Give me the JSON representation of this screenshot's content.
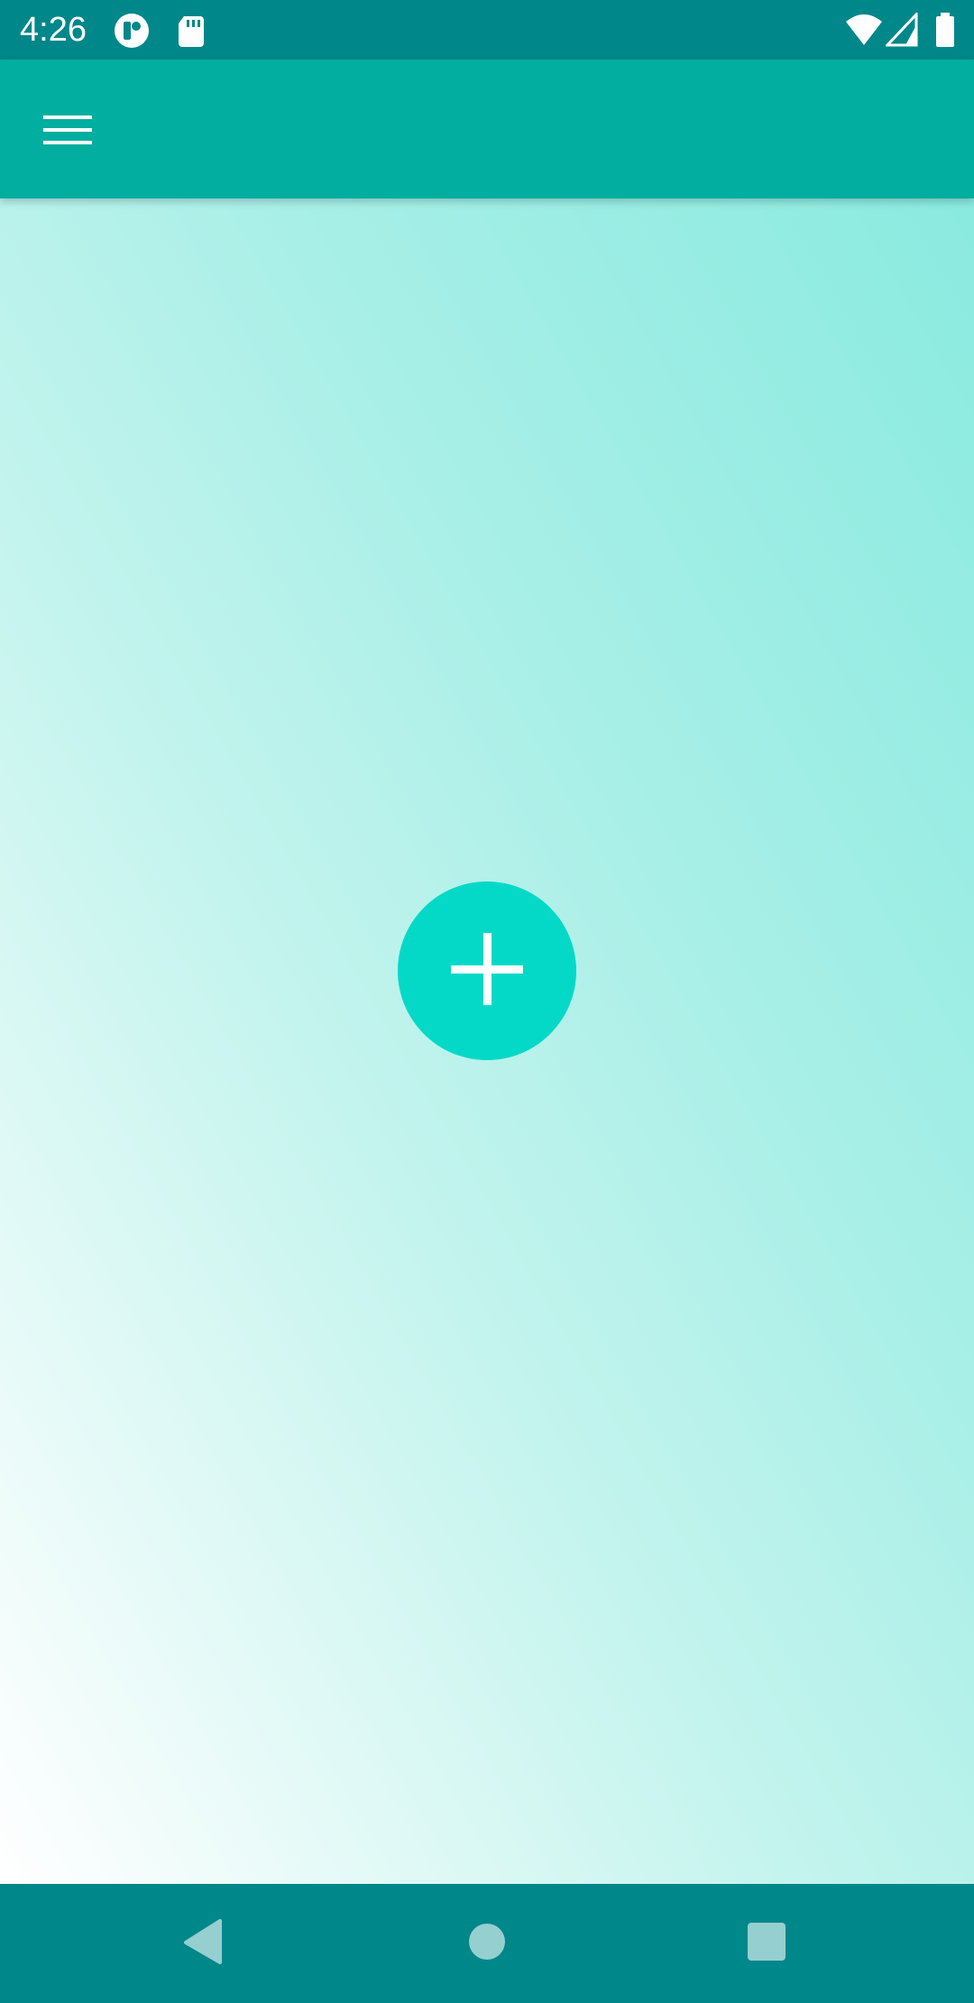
{
  "status_bar": {
    "time": "4:26",
    "left_icons": [
      "app-notification-icon",
      "sd-card-icon"
    ],
    "right_icons": [
      "wifi-icon",
      "cell-signal-icon",
      "battery-icon"
    ]
  },
  "app_bar": {
    "menu_icon": "hamburger-menu-icon"
  },
  "fab": {
    "icon": "plus-icon"
  },
  "nav_bar": {
    "buttons": [
      "back-icon",
      "home-icon",
      "recents-icon"
    ]
  },
  "colors": {
    "status_bar": "#00878a",
    "app_bar": "#02ae9f",
    "fab": "#04d9c8",
    "nav_bar": "#00878a",
    "gradient_top": "#8aeadf",
    "gradient_bottom": "#ffffff"
  }
}
